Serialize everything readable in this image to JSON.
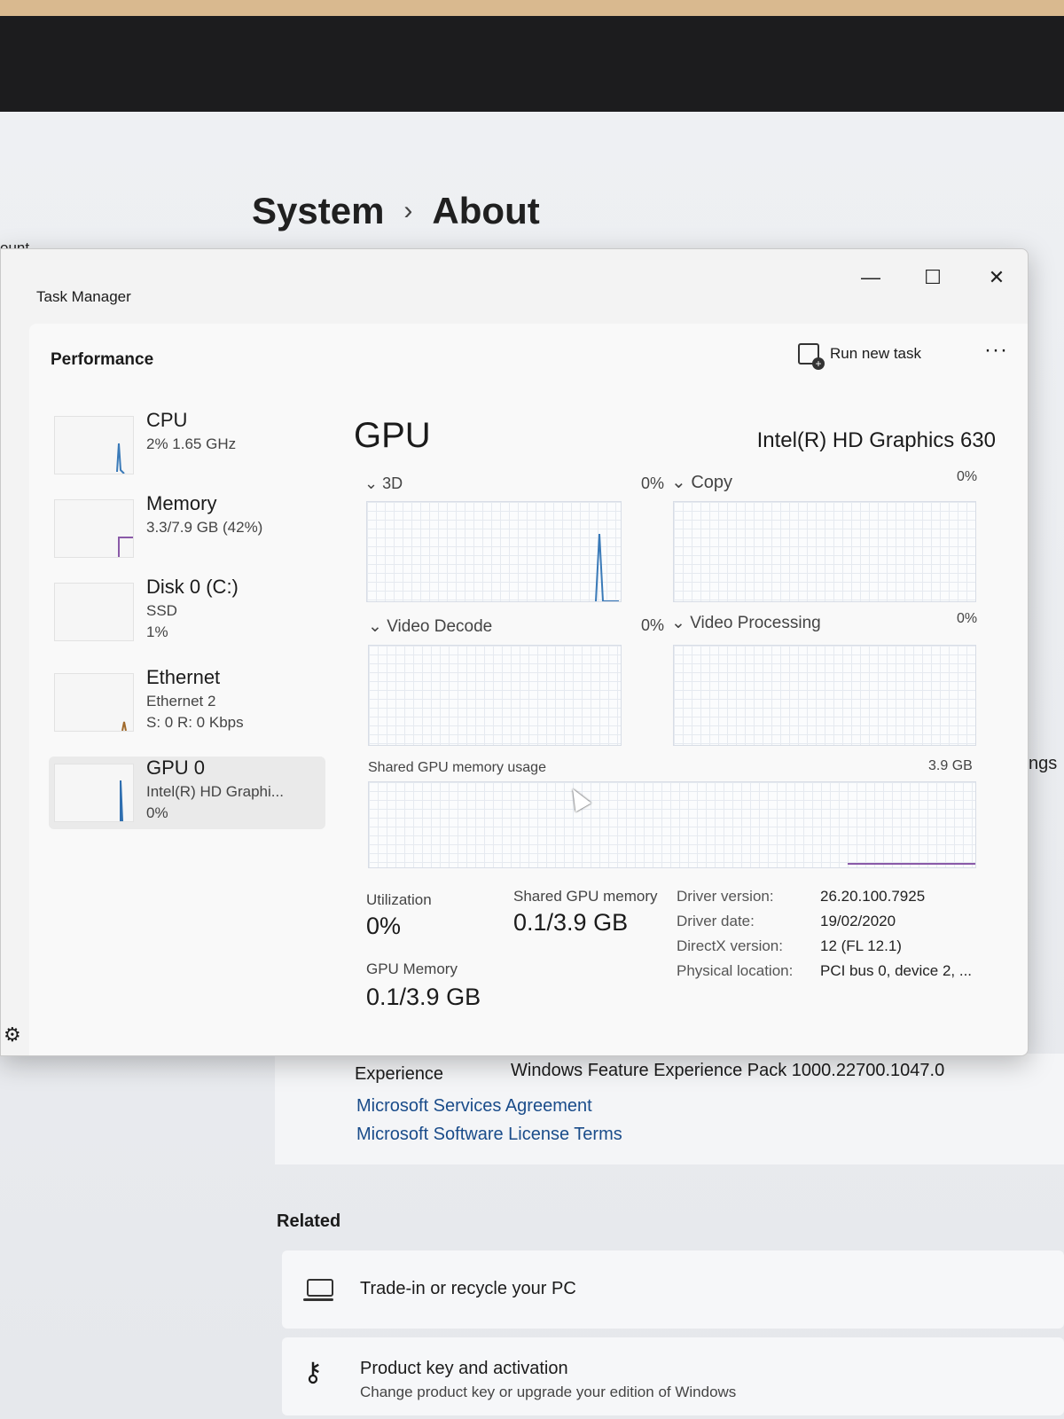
{
  "settings": {
    "breadcrumb": {
      "parent": "System",
      "chevron": "›",
      "current": "About"
    },
    "side_fragment": "ount",
    "side_fragment_right": "ngs",
    "experience": {
      "key": "Experience",
      "value": "Windows Feature Experience Pack 1000.22700.1047.0"
    },
    "links": [
      "Microsoft Services Agreement",
      "Microsoft Software License Terms"
    ],
    "related_heading": "Related",
    "related": [
      {
        "title": "Trade-in or recycle your PC",
        "icon": "laptop-icon"
      },
      {
        "title": "Product key and activation",
        "subtitle": "Change product key or upgrade your edition of Windows",
        "icon": "key-icon"
      }
    ]
  },
  "task_manager": {
    "title": "Task Manager",
    "controls": {
      "minimize": "—",
      "maximize": "☐",
      "close": "✕"
    },
    "page_title": "Performance",
    "run_new_task": "Run new task",
    "more": "···",
    "devices": [
      {
        "name": "CPU",
        "line2": "2% 1.65 GHz",
        "line3": "",
        "selected": false
      },
      {
        "name": "Memory",
        "line2": "3.3/7.9 GB (42%)",
        "line3": "",
        "selected": false
      },
      {
        "name": "Disk 0 (C:)",
        "line2": "SSD",
        "line3": "1%",
        "selected": false
      },
      {
        "name": "Ethernet",
        "line2": "Ethernet 2",
        "line3": "S: 0 R: 0 Kbps",
        "selected": false
      },
      {
        "name": "GPU 0",
        "line2": "Intel(R) HD Graphi...",
        "line3": "0%",
        "selected": true
      }
    ],
    "gpu": {
      "title": "GPU",
      "model": "Intel(R) HD Graphics 630",
      "engines": [
        {
          "label": "3D",
          "percent": "0%"
        },
        {
          "label": "Copy",
          "percent": "0%"
        },
        {
          "label": "Video Decode",
          "percent": "0%"
        },
        {
          "label": "Video Processing",
          "percent": "0%"
        }
      ],
      "shared_memory_chart": {
        "label": "Shared GPU memory usage",
        "max": "3.9 GB"
      },
      "stats": {
        "utilization_label": "Utilization",
        "utilization_value": "0%",
        "shared_label": "Shared GPU memory",
        "shared_value": "0.1/3.9 GB",
        "gpu_memory_label": "GPU Memory",
        "gpu_memory_value": "0.1/3.9 GB"
      },
      "info": [
        {
          "key": "Driver version:",
          "value": "26.20.100.7925"
        },
        {
          "key": "Driver date:",
          "value": "19/02/2020"
        },
        {
          "key": "DirectX version:",
          "value": "12 (FL 12.1)"
        },
        {
          "key": "Physical location:",
          "value": "PCI bus 0, device 2, ..."
        }
      ]
    }
  }
}
